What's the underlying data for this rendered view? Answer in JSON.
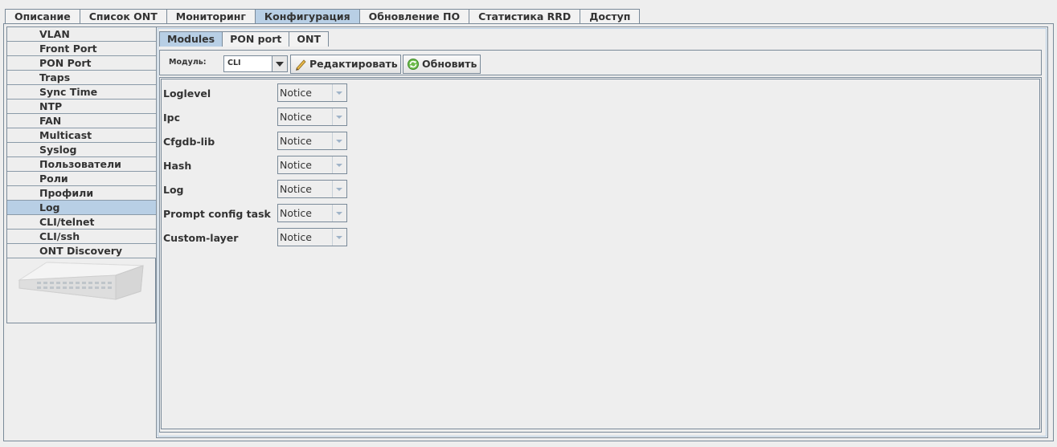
{
  "top_tabs": [
    "Описание",
    "Список ONT",
    "Мониторинг",
    "Конфигурация",
    "Обновление ПО",
    "Статистика RRD",
    "Доступ"
  ],
  "active_top_tab": "Конфигурация",
  "left_nav": {
    "items": [
      "VLAN",
      "Front Port",
      "PON Port",
      "Traps",
      "Sync Time",
      "NTP",
      "FAN",
      "Multicast",
      "Syslog",
      "Пользователи",
      "Роли",
      "Профили",
      "Log",
      "CLI/telnet",
      "CLI/ssh",
      "ONT Discovery"
    ],
    "active": "Log"
  },
  "sub_tabs": [
    "Modules",
    "PON port",
    "ONT"
  ],
  "active_sub_tab": "Modules",
  "toolbar": {
    "module_label": "Модуль:",
    "module_value": "CLI",
    "edit_label": "Редактировать",
    "edit_icon": "pencil-icon",
    "refresh_label": "Обновить",
    "refresh_icon": "refresh-icon"
  },
  "log_rows": [
    {
      "label": "Loglevel",
      "value": "Notice"
    },
    {
      "label": "Ipc",
      "value": "Notice"
    },
    {
      "label": "Cfgdb-lib",
      "value": "Notice"
    },
    {
      "label": "Hash",
      "value": "Notice"
    },
    {
      "label": "Log",
      "value": "Notice"
    },
    {
      "label": "Prompt config task",
      "value": "Notice"
    },
    {
      "label": "Custom-layer",
      "value": "Notice"
    }
  ],
  "colors": {
    "active_tab": "#b8cfe5",
    "border": "#7a8a99",
    "background": "#eeeeee"
  }
}
